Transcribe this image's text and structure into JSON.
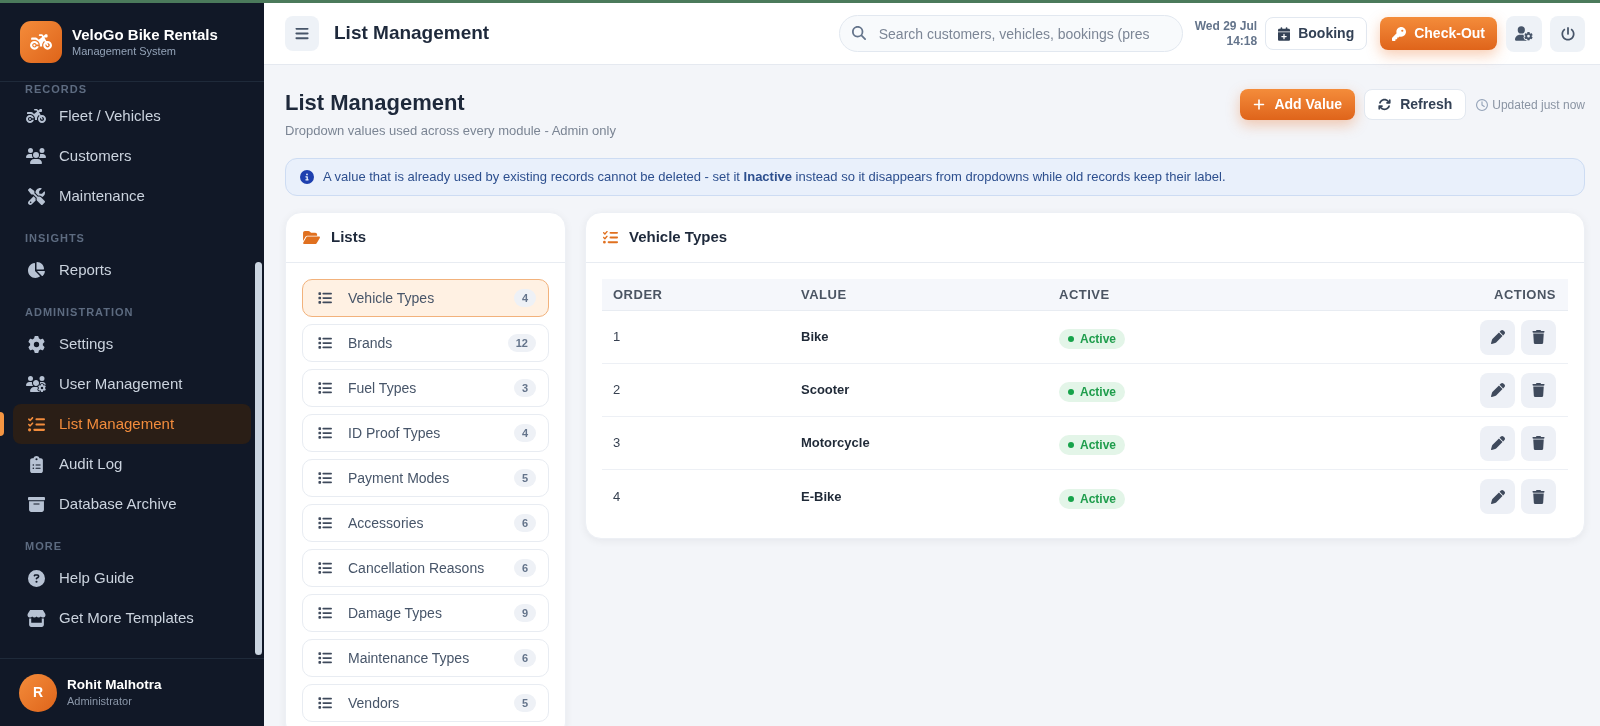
{
  "sidebar": {
    "brand": {
      "name": "VeloGo Bike Rentals",
      "subtitle": "Management System"
    },
    "sections": [
      {
        "label": "RECORDS",
        "items": [
          {
            "label": "Fleet / Vehicles",
            "selected": false
          },
          {
            "label": "Customers",
            "selected": false
          },
          {
            "label": "Maintenance",
            "selected": false
          }
        ]
      },
      {
        "label": "INSIGHTS",
        "items": [
          {
            "label": "Reports",
            "selected": false
          }
        ]
      },
      {
        "label": "ADMINISTRATION",
        "items": [
          {
            "label": "Settings",
            "selected": false
          },
          {
            "label": "User Management",
            "selected": false
          },
          {
            "label": "List Management",
            "selected": true
          },
          {
            "label": "Audit Log",
            "selected": false
          },
          {
            "label": "Database Archive",
            "selected": false
          }
        ]
      },
      {
        "label": "MORE",
        "items": [
          {
            "label": "Help Guide",
            "selected": false
          },
          {
            "label": "Get More Templates",
            "selected": false
          }
        ]
      }
    ],
    "user": {
      "initial": "R",
      "name": "Rohit Malhotra",
      "role": "Administrator"
    }
  },
  "topbar": {
    "title": "List Management",
    "search": {
      "placeholder": "Search customers, vehicles, bookings (pres"
    },
    "date": "Wed 29 Jul",
    "time": "14:18",
    "buttons": [
      {
        "label": "Booking",
        "kind": "outline"
      },
      {
        "label": "Check-Out",
        "kind": "primary"
      }
    ]
  },
  "page_header": {
    "title": "List Management",
    "subtitle": "Dropdown values used across every module - Admin only",
    "buttons": [
      {
        "label": "Add Value",
        "kind": "primary"
      },
      {
        "label": "Refresh",
        "kind": "outline"
      }
    ],
    "updated": "Updated just now"
  },
  "notice": {
    "text": "A value that is already used by existing records cannot be deleted - set it **Inactive** instead so it disappears from dropdowns while old records keep their label."
  },
  "lists_panel": {
    "title": "Lists",
    "items": [
      {
        "label": "Vehicle Types",
        "count": "4",
        "selected": true
      },
      {
        "label": "Brands",
        "count": "12",
        "selected": false
      },
      {
        "label": "Fuel Types",
        "count": "3",
        "selected": false
      },
      {
        "label": "ID Proof Types",
        "count": "4",
        "selected": false
      },
      {
        "label": "Payment Modes",
        "count": "5",
        "selected": false
      },
      {
        "label": "Accessories",
        "count": "6",
        "selected": false
      },
      {
        "label": "Cancellation Reasons",
        "count": "6",
        "selected": false
      },
      {
        "label": "Damage Types",
        "count": "9",
        "selected": false
      },
      {
        "label": "Maintenance Types",
        "count": "6",
        "selected": false
      },
      {
        "label": "Vendors",
        "count": "5",
        "selected": false
      }
    ]
  },
  "values_panel": {
    "title": "Vehicle Types",
    "columns": [
      "ORDER",
      "VALUE",
      "ACTIVE",
      "ACTIONS"
    ],
    "rows": [
      {
        "order": "1",
        "value": "Bike",
        "status": "Active",
        "active": true
      },
      {
        "order": "2",
        "value": "Scooter",
        "status": "Active",
        "active": true
      },
      {
        "order": "3",
        "value": "Motorcycle",
        "status": "Active",
        "active": true
      },
      {
        "order": "4",
        "value": "E-Bike",
        "status": "Active",
        "active": true
      }
    ]
  }
}
